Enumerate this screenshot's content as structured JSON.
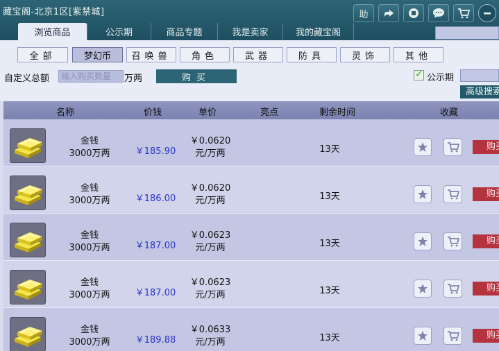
{
  "window": {
    "title": "藏宝阁-北京1区[紫禁城]",
    "icons": [
      "help-icon",
      "share-icon",
      "record-icon",
      "chat-icon",
      "cart-icon",
      "minimize-icon"
    ],
    "help_label": "助"
  },
  "tabs": [
    {
      "label": "浏览商品",
      "active": true
    },
    {
      "label": "公示期",
      "active": false
    },
    {
      "label": "商品专题",
      "active": false
    },
    {
      "label": "我是卖家",
      "active": false
    },
    {
      "label": "我的藏宝阁",
      "active": false
    }
  ],
  "categories": [
    {
      "label": "全部",
      "active": false
    },
    {
      "label": "梦幻币",
      "active": true
    },
    {
      "label": "召唤兽",
      "active": false
    },
    {
      "label": "角色",
      "active": false
    },
    {
      "label": "武器",
      "active": false
    },
    {
      "label": "防具",
      "active": false
    },
    {
      "label": "灵饰",
      "active": false
    },
    {
      "label": "其他",
      "active": false
    }
  ],
  "buy_bar": {
    "label": "自定义总额",
    "placeholder": "输入购买数量",
    "unit": "万两",
    "button": "购买",
    "public_period_label": "公示期",
    "public_period_checked": true,
    "advanced_search": "高级搜索"
  },
  "table": {
    "headers": {
      "name": "名称",
      "price": "价钱",
      "unit_price": "单价",
      "highlight": "亮点",
      "remaining": "剩余时间",
      "favorite": "收藏"
    },
    "rows": [
      {
        "name": "金钱",
        "amount": "3000万两",
        "price": "￥185.90",
        "unit_price": "￥0.0620",
        "unit_suffix": "元/万两",
        "remaining": "13天",
        "buy": "购买"
      },
      {
        "name": "金钱",
        "amount": "3000万两",
        "price": "￥186.00",
        "unit_price": "￥0.0620",
        "unit_suffix": "元/万两",
        "remaining": "13天",
        "buy": "购买"
      },
      {
        "name": "金钱",
        "amount": "3000万两",
        "price": "￥187.00",
        "unit_price": "￥0.0623",
        "unit_suffix": "元/万两",
        "remaining": "13天",
        "buy": "购买"
      },
      {
        "name": "金钱",
        "amount": "3000万两",
        "price": "￥187.00",
        "unit_price": "￥0.0623",
        "unit_suffix": "元/万两",
        "remaining": "13天",
        "buy": "购买"
      },
      {
        "name": "金钱",
        "amount": "3000万两",
        "price": "￥189.88",
        "unit_price": "￥0.0633",
        "unit_suffix": "元/万两",
        "remaining": "13天",
        "buy": "购买"
      }
    ]
  },
  "colors": {
    "header_teal": "#2d6476",
    "price_blue": "#2d33c9",
    "buy_red": "#b5323f",
    "check_green": "#3aa53a"
  }
}
